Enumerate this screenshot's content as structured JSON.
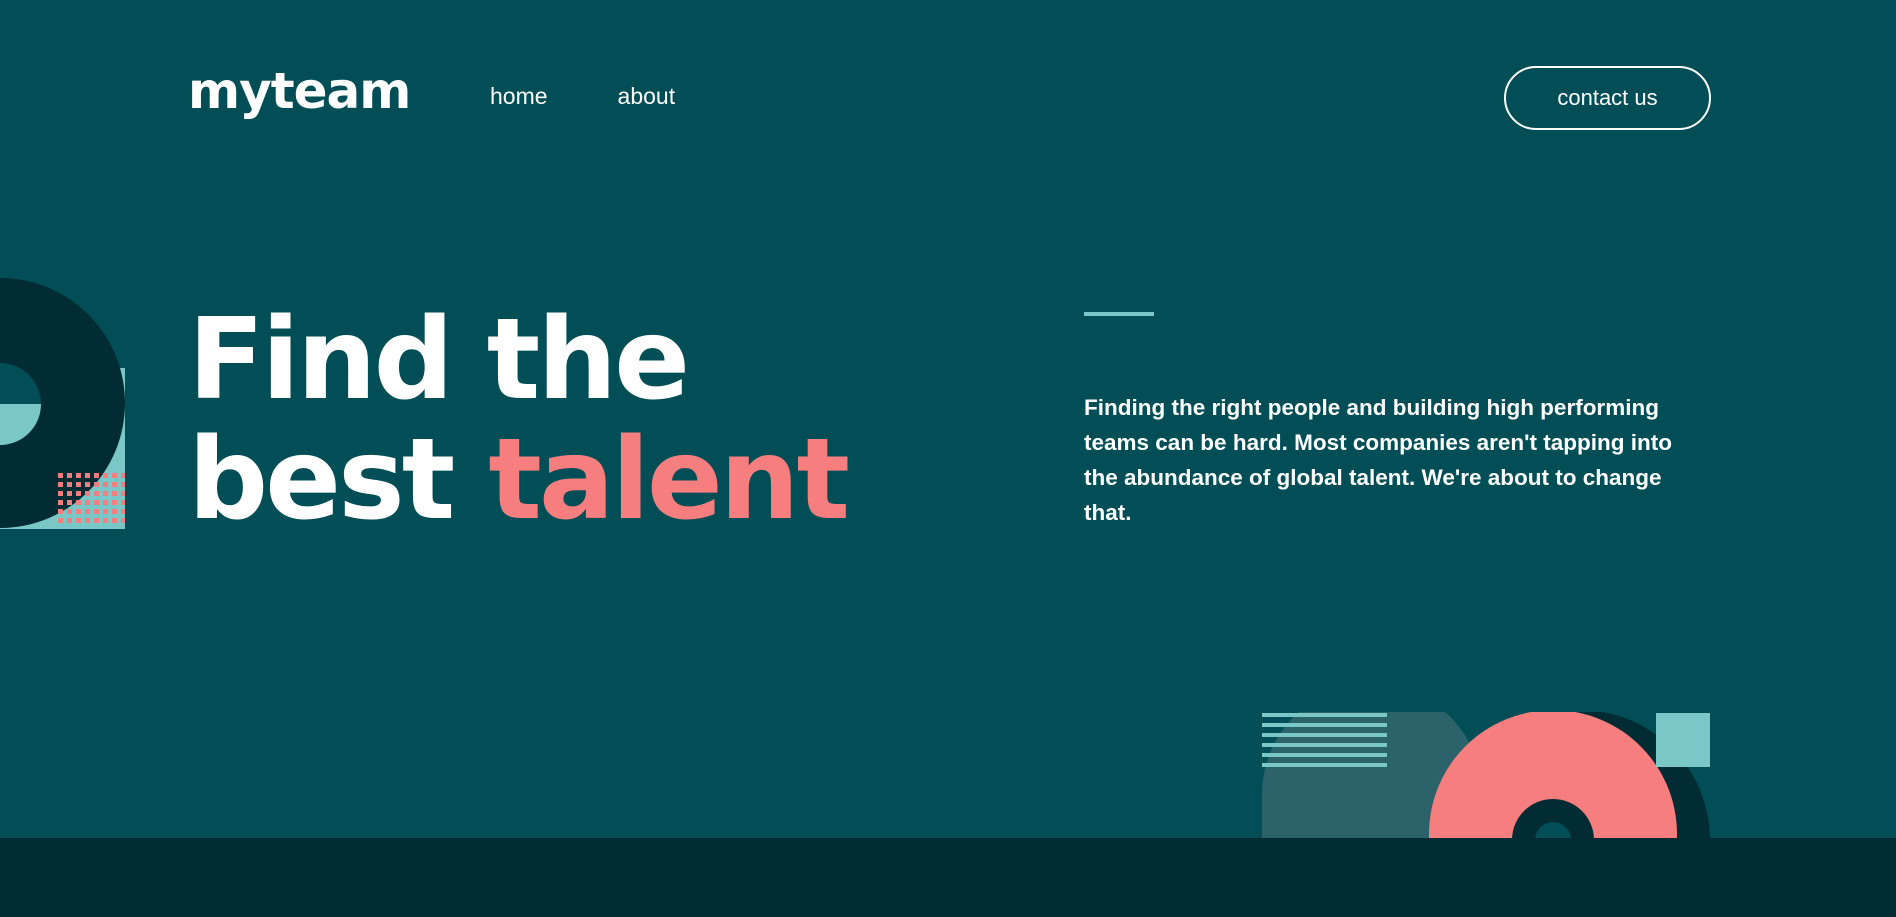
{
  "header": {
    "logo": "myteam",
    "nav": [
      {
        "label": "home"
      },
      {
        "label": "about"
      }
    ],
    "contact_button": "contact us"
  },
  "hero": {
    "title_line1": "Find the",
    "title_line2_plain": "best ",
    "title_line2_accent": "talent",
    "description": "Finding the right people and building high performing teams can be hard. Most companies aren't tapping into the abundance of global talent. We're about to change that."
  },
  "colors": {
    "background": "#014e56",
    "accent_coral": "#f67e7e",
    "accent_teal": "#79c8c7",
    "dark_teal": "#022c33",
    "mid_teal": "#2c6269",
    "text": "#ffffff"
  }
}
